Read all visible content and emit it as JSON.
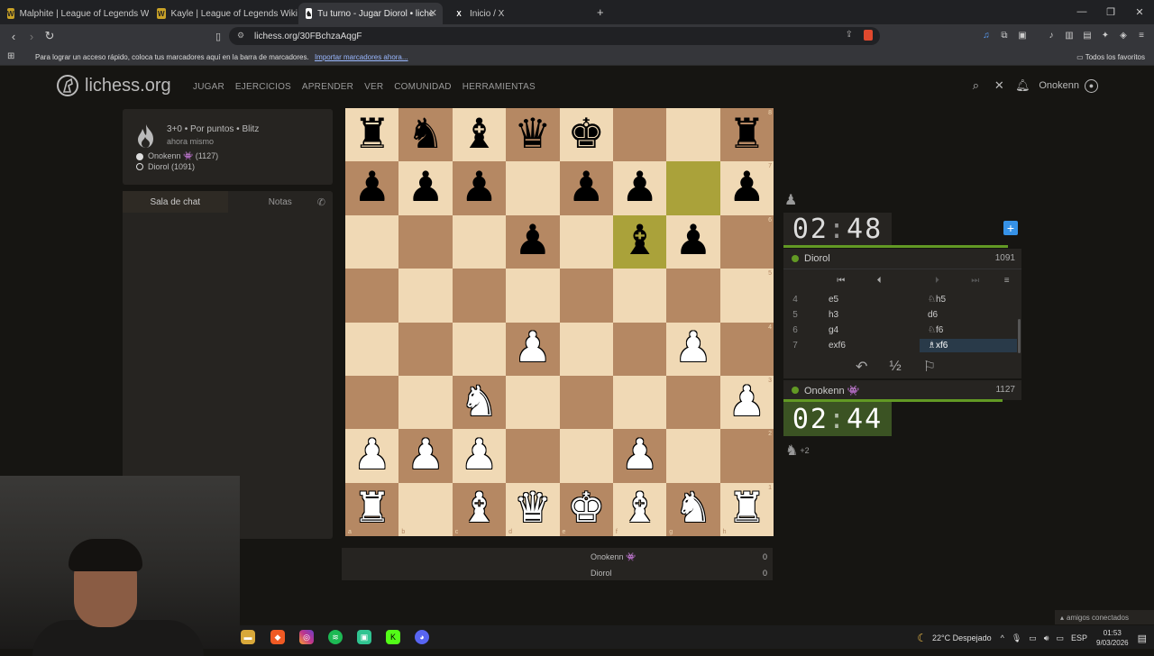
{
  "browser": {
    "tabs": [
      {
        "label": "Malphite | League of Legends Wiki",
        "icon": "W"
      },
      {
        "label": "Kayle | League of Legends Wiki",
        "icon": "W"
      },
      {
        "label": "Tu turno - Jugar Diorol • liche",
        "icon": "L"
      },
      {
        "label": "Inicio / X",
        "icon": "X"
      }
    ],
    "url": "lichess.org/30FBchzaAqgF",
    "bookmarks_msg": "Para lograr un acceso rápido, coloca tus marcadores aquí en la barra de marcadores.",
    "bookmarks_link": "Importar marcadores ahora...",
    "all_favorites": "Todos los favoritos"
  },
  "site": {
    "logo": "lichess.org",
    "nav": [
      "JUGAR",
      "EJERCICIOS",
      "APRENDER",
      "VER",
      "COMUNIDAD",
      "HERRAMIENTAS"
    ],
    "username": "Onokenn"
  },
  "game": {
    "mode": "3+0 • Por puntos • Blitz",
    "started": "ahora mismo",
    "white_player": "Onokenn 👾 (1127)",
    "black_player": "Diorol (1091)"
  },
  "chat": {
    "tab_chat": "Sala de chat",
    "tab_notes": "Notas",
    "input_hint": "t"
  },
  "board": {
    "files": [
      "a",
      "b",
      "c",
      "d",
      "e",
      "f",
      "g",
      "h"
    ],
    "ranks": [
      "8",
      "7",
      "6",
      "5",
      "4",
      "3",
      "2",
      "1"
    ],
    "position": [
      [
        "br",
        "bn",
        "bb",
        "bq",
        "bk",
        "",
        "",
        "br"
      ],
      [
        "bp",
        "bp",
        "bp",
        "",
        "bp",
        "bp",
        "",
        "bp"
      ],
      [
        "",
        "",
        "",
        "bp",
        "",
        "bb",
        "bp",
        ""
      ],
      [
        "",
        "",
        "",
        "",
        "",
        "",
        "",
        ""
      ],
      [
        "",
        "",
        "",
        "wp",
        "",
        "",
        "wp",
        ""
      ],
      [
        "",
        "",
        "wn",
        "",
        "",
        "",
        "",
        "wp"
      ],
      [
        "wp",
        "wp",
        "wp",
        "",
        "",
        "wp",
        "",
        ""
      ],
      [
        "wr",
        "",
        "wb",
        "wq",
        "wk",
        "wb",
        "wn",
        "wr"
      ]
    ],
    "highlights": [
      "g7",
      "f6"
    ]
  },
  "scores": [
    {
      "name": "Onokenn 👾",
      "score": "0"
    },
    {
      "name": "Diorol",
      "score": "0"
    }
  ],
  "opponent": {
    "name": "Diorol",
    "rating": "1091",
    "clock_min": "02",
    "clock_sec": "48"
  },
  "me": {
    "name": "Onokenn 👾",
    "rating": "1127",
    "clock_min": "02",
    "clock_sec": "44",
    "material": "+2"
  },
  "moves": [
    {
      "n": "4",
      "white": "e5",
      "black": "♘h5"
    },
    {
      "n": "5",
      "white": "h3",
      "black": "d6"
    },
    {
      "n": "6",
      "white": "g4",
      "black": "♘f6"
    },
    {
      "n": "7",
      "white": "exf6",
      "black": "♗xf6"
    }
  ],
  "taskbar": {
    "weather": "22°C Despejado",
    "lang": "ESP",
    "time": "01:53",
    "date": "9/03/2026",
    "friends": "amigos conectados"
  }
}
